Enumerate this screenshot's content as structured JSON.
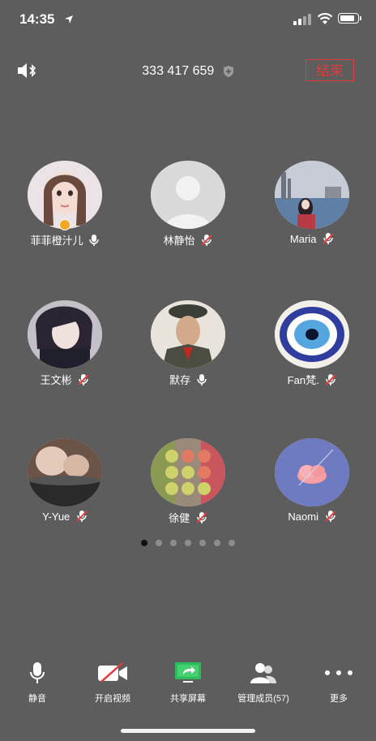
{
  "status": {
    "time": "14:35"
  },
  "meeting": {
    "id": "333 417 659",
    "end_label": "结束"
  },
  "participants": [
    {
      "name": "菲菲橙汁儿",
      "muted": false,
      "host": true
    },
    {
      "name": "林静怡",
      "muted": true,
      "host": false
    },
    {
      "name": "Maria",
      "muted": true,
      "host": false
    },
    {
      "name": "王文彬",
      "muted": true,
      "host": false
    },
    {
      "name": "默存",
      "muted": false,
      "host": false
    },
    {
      "name": "Fan梵.",
      "muted": true,
      "host": false
    },
    {
      "name": "Y-Yue",
      "muted": true,
      "host": false
    },
    {
      "name": "徐健",
      "muted": true,
      "host": false
    },
    {
      "name": "Naomi",
      "muted": true,
      "host": false
    }
  ],
  "pagination": {
    "pages": 7,
    "current": 1
  },
  "toolbar": {
    "mute": "静音",
    "video": "开启视频",
    "share": "共享屏幕",
    "members": "管理成员(57)",
    "more": "更多"
  },
  "colors": {
    "background": "#5d5d5d",
    "end": "#e23b3b",
    "mute": "#e23b3b",
    "share": "#2dbb5d"
  }
}
